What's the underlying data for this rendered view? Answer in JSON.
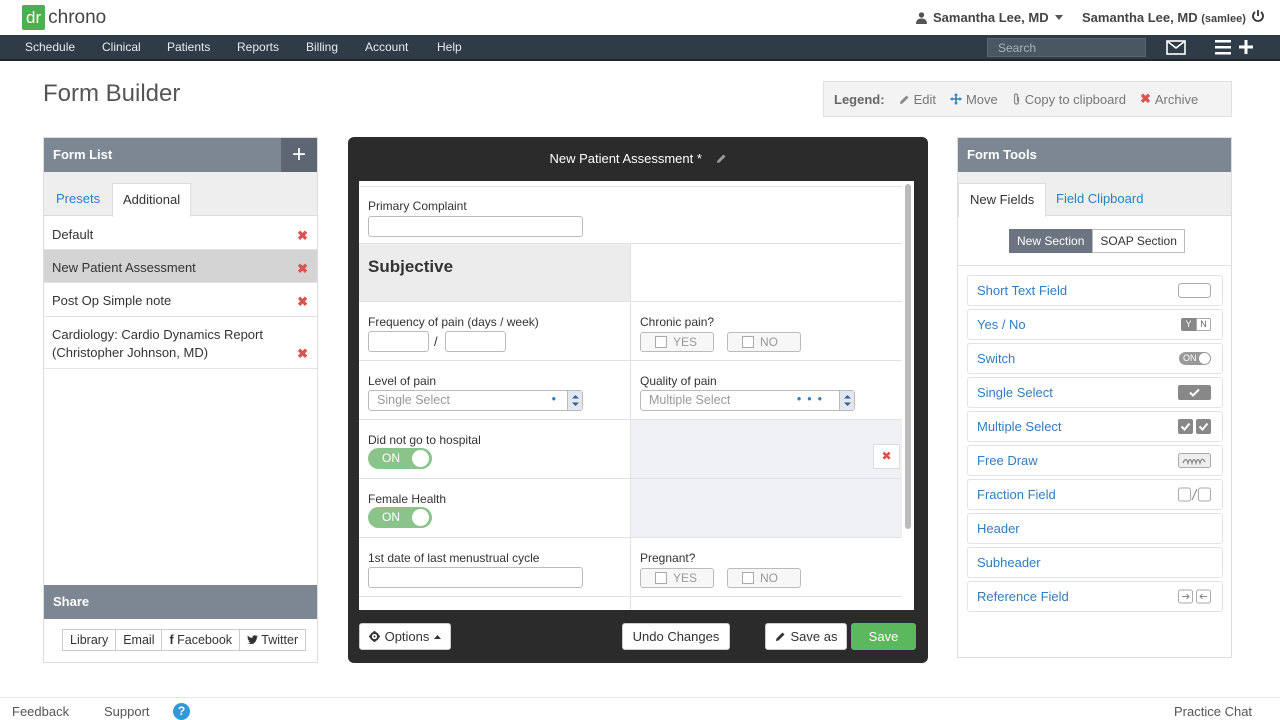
{
  "brand": {
    "logo_dr": "dr",
    "logo_chrono": "chrono"
  },
  "header": {
    "user_menu": "Samantha Lee, MD",
    "user_name": "Samantha Lee, MD",
    "username": "(samlee)"
  },
  "nav": {
    "items": [
      "Schedule",
      "Clinical",
      "Patients",
      "Reports",
      "Billing",
      "Account",
      "Help"
    ],
    "search_placeholder": "Search"
  },
  "page": {
    "title": "Form Builder"
  },
  "legend": {
    "label": "Legend:",
    "edit": "Edit",
    "move": "Move",
    "copy": "Copy to clipboard",
    "archive": "Archive"
  },
  "form_list": {
    "title": "Form List",
    "tabs": [
      "Presets",
      "Additional"
    ],
    "active_tab": "Additional",
    "items": [
      "Default",
      "New Patient Assessment",
      "Post Op Simple note",
      "Cardiology: Cardio Dynamics Report (Christopher Johnson, MD)"
    ],
    "selected": "New Patient Assessment"
  },
  "share": {
    "title": "Share",
    "buttons": [
      "Library",
      "Email",
      "Facebook",
      "Twitter"
    ]
  },
  "builder": {
    "title": "New Patient Assessment *",
    "fields": {
      "primary_complaint": "Primary Complaint",
      "subjective": "Subjective",
      "frequency": "Frequency of pain (days / week)",
      "fraction_sep": "/",
      "chronic": "Chronic pain?",
      "yes": "YES",
      "no": "NO",
      "level": "Level of pain",
      "level_placeholder": "Single Select",
      "quality": "Quality of pain",
      "quality_placeholder": "Multiple Select",
      "hospital": "Did not go to hospital",
      "toggle_on": "ON",
      "female": "Female Health",
      "menstrual": "1st date of last menustrual cycle",
      "pregnant": "Pregnant?"
    },
    "buttons": {
      "options": "Options",
      "undo": "Undo Changes",
      "save_as": "Save as",
      "save": "Save"
    }
  },
  "form_tools": {
    "title": "Form Tools",
    "tabs": [
      "New Fields",
      "Field Clipboard"
    ],
    "sections": [
      "New Section",
      "SOAP Section"
    ],
    "tools": [
      "Short Text Field",
      "Yes / No",
      "Switch",
      "Single Select",
      "Multiple Select",
      "Free Draw",
      "Fraction Field",
      "Header",
      "Subheader",
      "Reference Field"
    ],
    "yn_y": "Y",
    "yn_n": "N",
    "switch_on": "ON"
  },
  "footer": {
    "feedback": "Feedback",
    "support": "Support",
    "help": "?",
    "chat": "Practice Chat"
  },
  "colors": {
    "nav": "#2f3b47",
    "brand_green": "#4caf50",
    "link_blue": "#2f7ec1",
    "save_green": "#5cb85c",
    "delete_red": "#d9534f"
  }
}
